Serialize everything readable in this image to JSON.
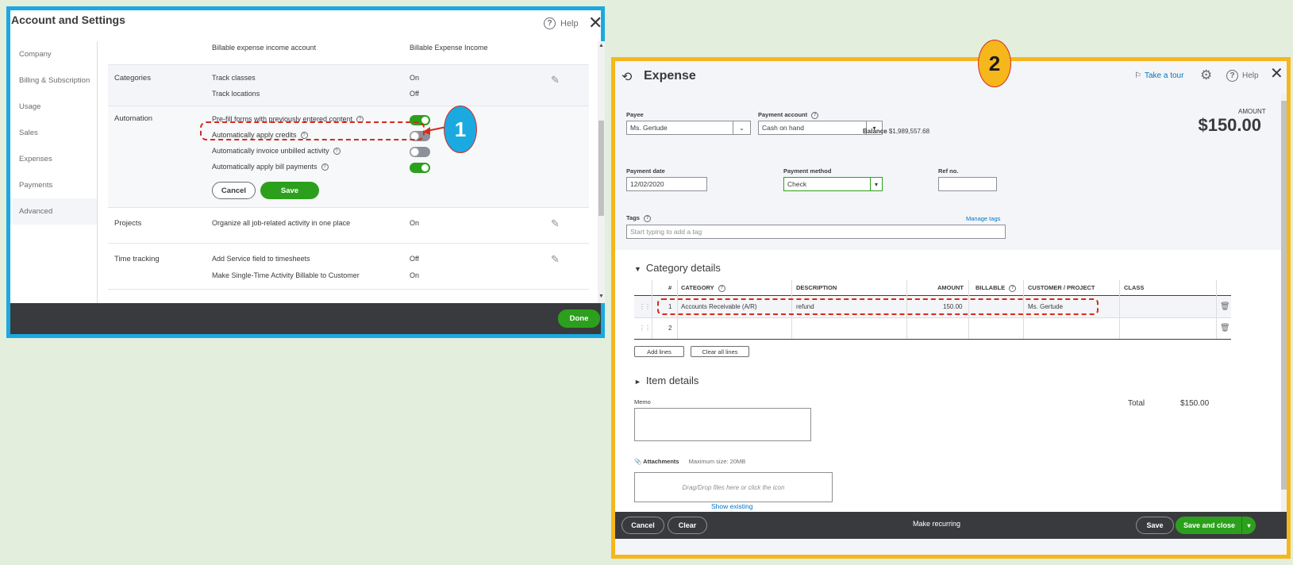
{
  "settings": {
    "title": "Account and Settings",
    "help": "Help",
    "sidebar": [
      "Company",
      "Billing & Subscription",
      "Usage",
      "Sales",
      "Expenses",
      "Payments",
      "Advanced"
    ],
    "top_row": {
      "label": "Billable expense income account",
      "value": "Billable Expense Income"
    },
    "categories": {
      "label": "Categories",
      "rows": [
        {
          "label": "Track classes",
          "value": "On"
        },
        {
          "label": "Track locations",
          "value": "Off"
        }
      ]
    },
    "automation": {
      "label": "Automation",
      "rows": [
        {
          "label": "Pre-fill forms with previously entered content",
          "state": "on"
        },
        {
          "label": "Automatically apply credits",
          "state": "off"
        },
        {
          "label": "Automatically invoice unbilled activity",
          "state": "off"
        },
        {
          "label": "Automatically apply bill payments",
          "state": "on"
        }
      ],
      "cancel": "Cancel",
      "save": "Save"
    },
    "projects": {
      "label": "Projects",
      "row": "Organize all job-related activity in one place",
      "value": "On"
    },
    "time_tracking": {
      "label": "Time tracking",
      "rows": [
        {
          "label": "Add Service field to timesheets",
          "value": "Off"
        },
        {
          "label": "Make Single-Time Activity Billable to Customer",
          "value": "On"
        }
      ]
    },
    "done": "Done",
    "callout": "1"
  },
  "expense": {
    "title": "Expense",
    "take_tour": "Take a tour",
    "help": "Help",
    "payee": {
      "label": "Payee",
      "value": "Ms. Gertude"
    },
    "payment_account": {
      "label": "Payment account",
      "value": "Cash on hand"
    },
    "balance_label": "Balance",
    "balance_value": "$1,989,557.68",
    "amount_label": "AMOUNT",
    "amount": "$150.00",
    "payment_date": {
      "label": "Payment date",
      "value": "12/02/2020"
    },
    "payment_method": {
      "label": "Payment method",
      "value": "Check"
    },
    "ref_no": {
      "label": "Ref no.",
      "value": ""
    },
    "tags": {
      "label": "Tags",
      "placeholder": "Start typing to add a tag",
      "manage": "Manage tags"
    },
    "category_details": "Category details",
    "columns": [
      "#",
      "CATEGORY",
      "DESCRIPTION",
      "AMOUNT",
      "BILLABLE",
      "CUSTOMER / PROJECT",
      "CLASS"
    ],
    "rows": [
      {
        "num": "1",
        "category": "Accounts Receivable (A/R)",
        "description": "refund",
        "amount": "150.00",
        "billable": "",
        "customer": "Ms. Gertude",
        "class": ""
      },
      {
        "num": "2",
        "category": "",
        "description": "",
        "amount": "",
        "billable": "",
        "customer": "",
        "class": ""
      }
    ],
    "add_lines": "Add lines",
    "clear_all_lines": "Clear all lines",
    "item_details": "Item details",
    "memo": "Memo",
    "total_label": "Total",
    "total_value": "$150.00",
    "attachments": "Attachments",
    "max_size": "Maximum size: 20MB",
    "drop_text": "Drag/Drop files here or click the icon",
    "show_existing": "Show existing",
    "footer": {
      "cancel": "Cancel",
      "clear": "Clear",
      "make_recurring": "Make recurring",
      "save": "Save",
      "save_close": "Save and close"
    },
    "callout": "2"
  }
}
